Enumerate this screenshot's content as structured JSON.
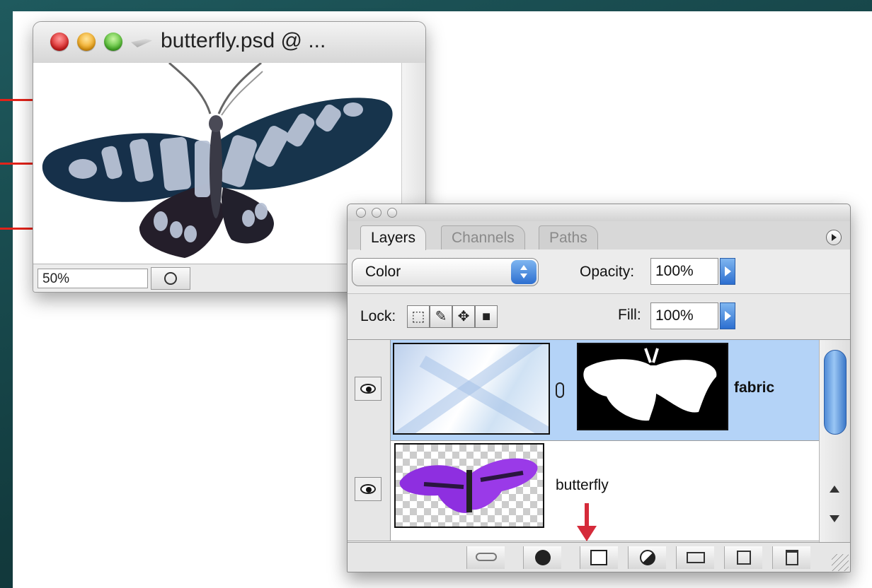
{
  "document_window": {
    "title": "butterfly.psd @ ...",
    "zoom": "50%"
  },
  "layers_palette": {
    "tabs": [
      {
        "label": "Layers",
        "active": true
      },
      {
        "label": "Channels",
        "active": false
      },
      {
        "label": "Paths",
        "active": false
      }
    ],
    "blend_mode": "Color",
    "opacity_label": "Opacity:",
    "opacity_value": "100%",
    "lock_label": "Lock:",
    "fill_label": "Fill:",
    "fill_value": "100%",
    "layers": [
      {
        "name": "fabric",
        "selected": true,
        "visible": true,
        "has_mask": true
      },
      {
        "name": "butterfly",
        "selected": false,
        "visible": true,
        "has_mask": false
      }
    ],
    "bottom_buttons": [
      "link-icon",
      "layer-style-icon",
      "add-mask-icon",
      "adjustment-layer-icon",
      "new-group-icon",
      "new-layer-icon",
      "trash-icon"
    ]
  },
  "colors": {
    "annotation_red": "#e2231a",
    "selection_blue": "#b4d3f7",
    "accent_blue": "#2d6fd0"
  }
}
